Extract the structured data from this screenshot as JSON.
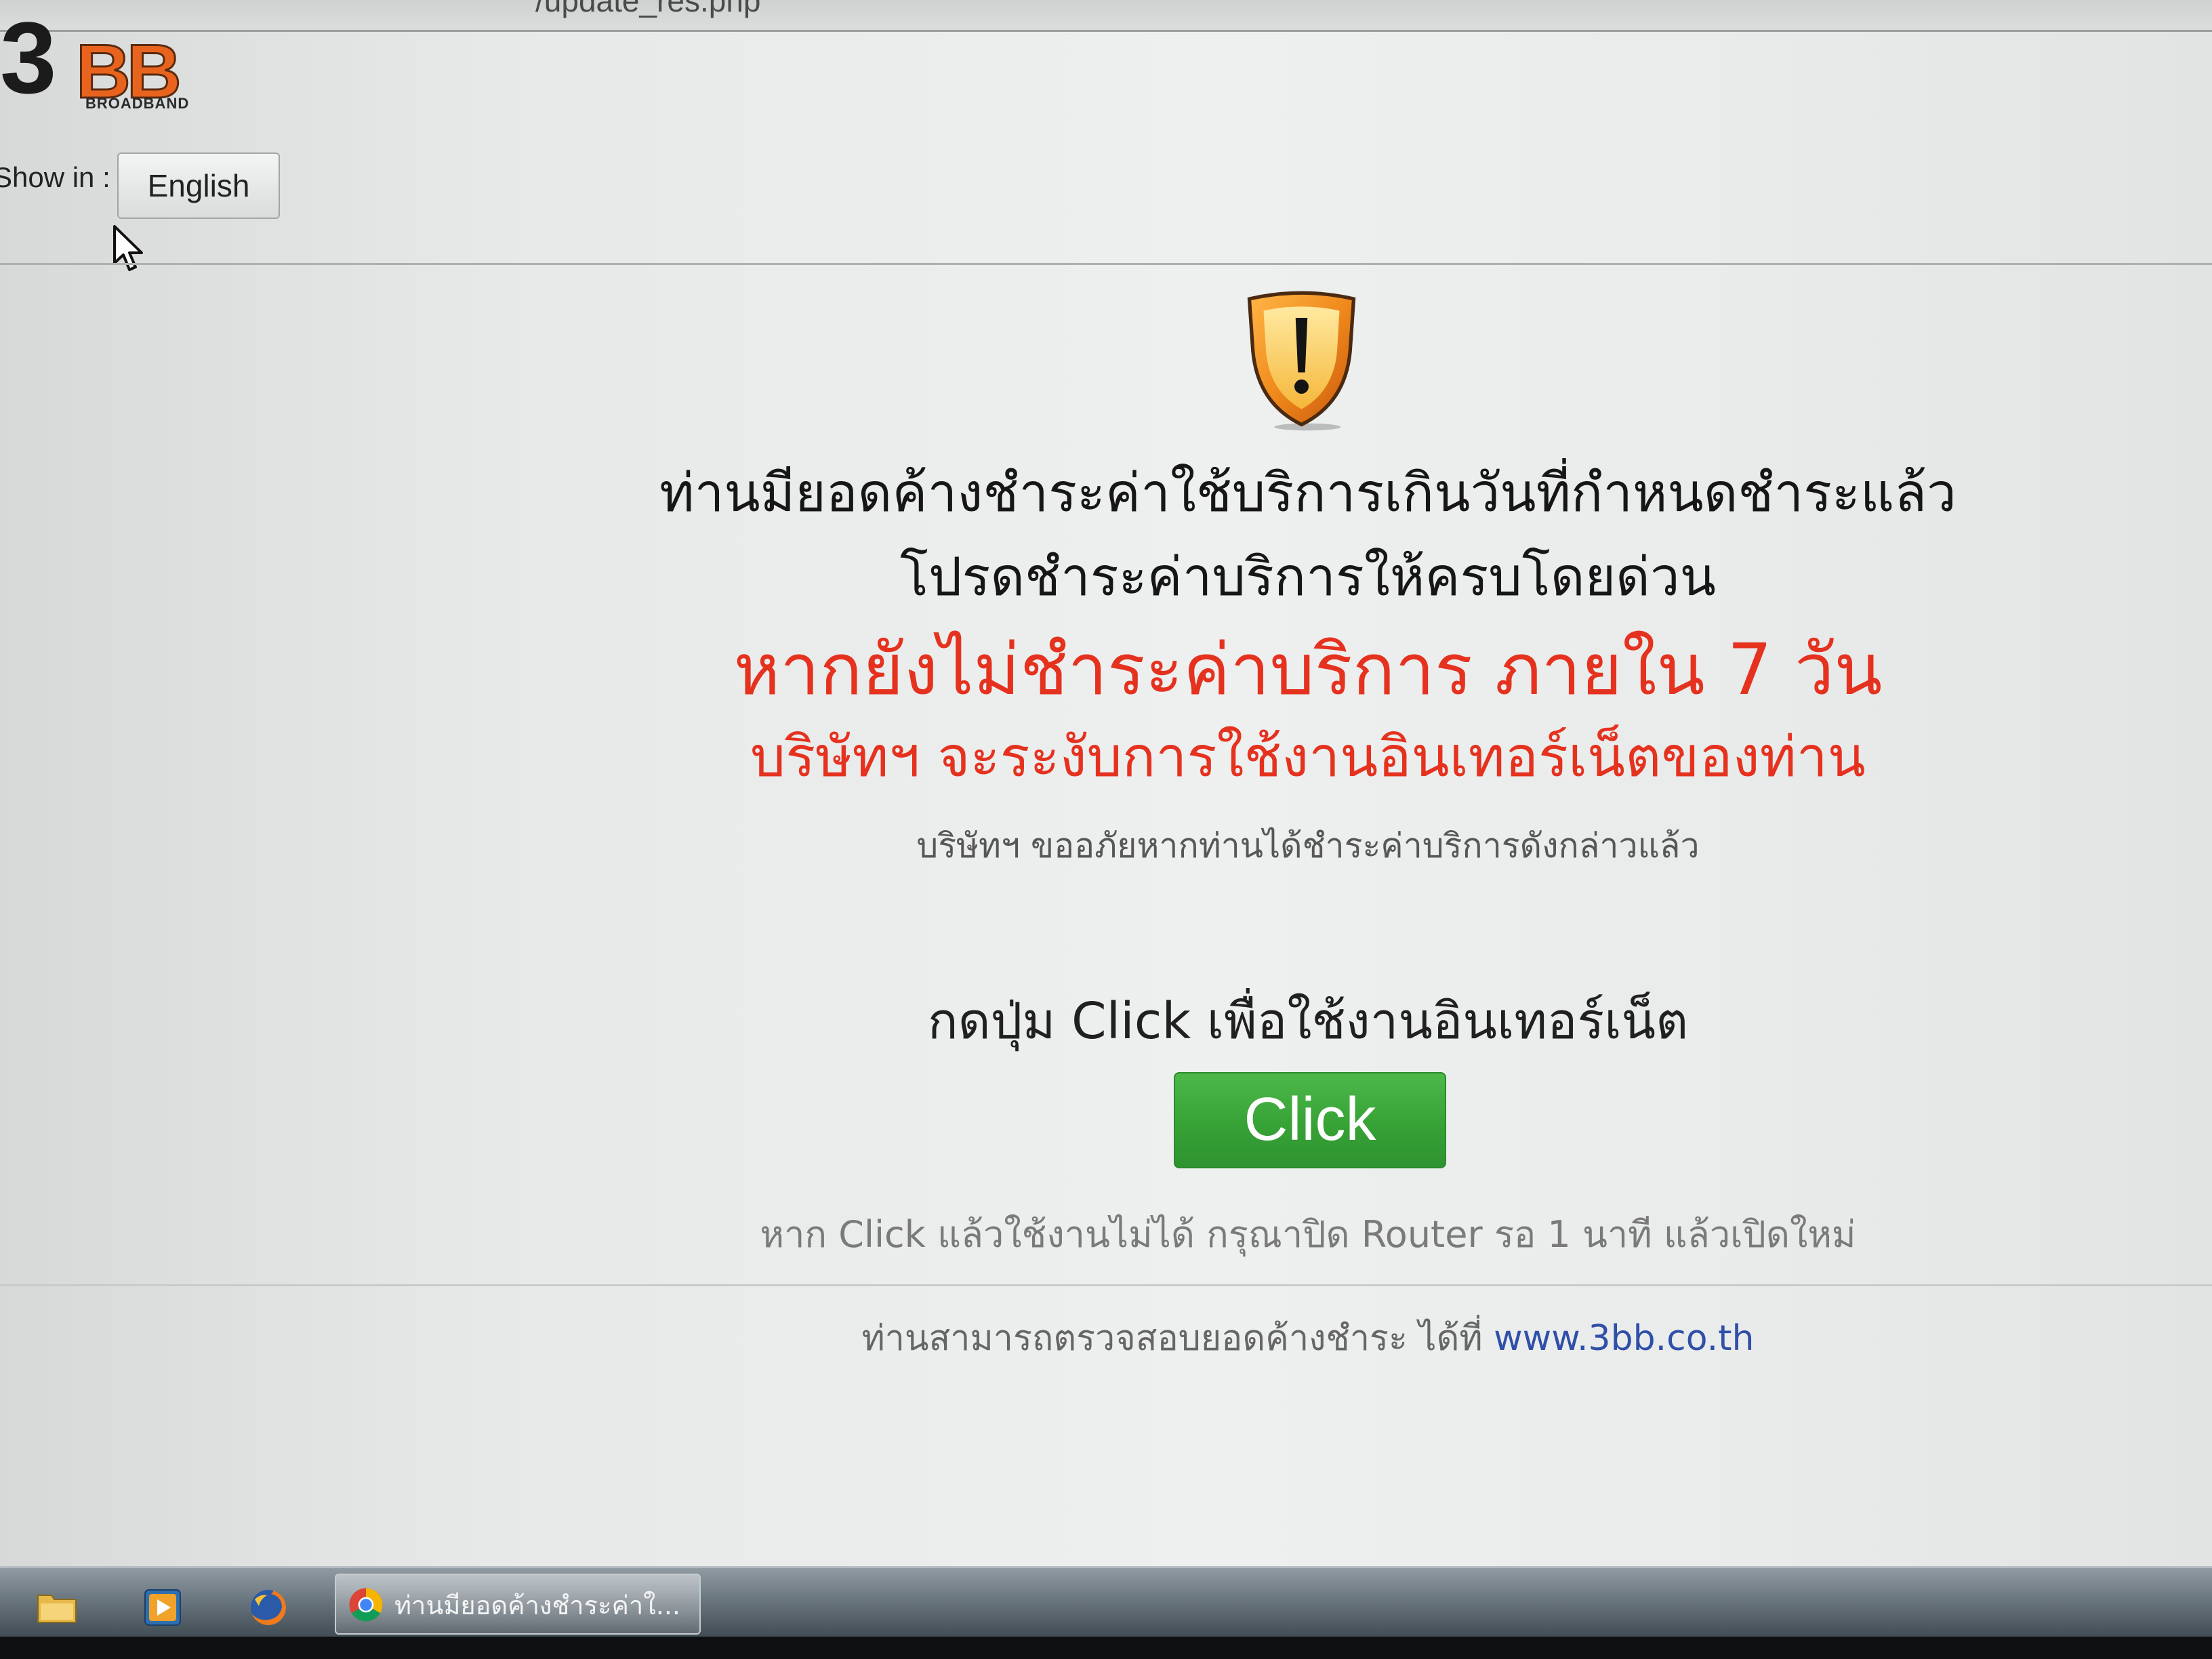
{
  "browser": {
    "address_fragment": "/update_res.php"
  },
  "header": {
    "logo_main": "3",
    "logo_bb": "BB",
    "logo_sub": "BROADBAND",
    "show_in_label": "Show in :",
    "language_button": "English"
  },
  "notice": {
    "line1": "ท่านมียอดค้างชำระค่าใช้บริการเกินวันที่กำหนดชำระแล้ว",
    "line2": "โปรดชำระค่าบริการให้ครบโดยด่วน",
    "warning_line1": "หากยังไม่ชำระค่าบริการ ภายใน 7 วัน",
    "warning_line2": "บริษัทฯ จะระงับการใช้งานอินเทอร์เน็ตของท่าน",
    "apology": "บริษัทฯ ขออภัยหากท่านได้ชำระค่าบริการดังกล่าวแล้ว",
    "instruction": "กดปุ่ม Click เพื่อใช้งานอินเทอร์เน็ต",
    "button_label": "Click",
    "router_hint": "หาก Click แล้วใช้งานไม่ได้ กรุณาปิด Router รอ 1 นาที แล้วเปิดใหม่",
    "check_text": "ท่านสามารถตรวจสอบยอดค้างชำระ ได้ที่ ",
    "check_link": "www.3bb.co.th"
  },
  "taskbar": {
    "icons": [
      "folder-icon",
      "media-player-icon",
      "firefox-icon",
      "chrome-icon"
    ],
    "active_window_title": "ท่านมียอดค้างชำระค่าใ..."
  },
  "icons": {
    "warning": "warning-shield-icon",
    "pointer": "mouse-cursor-icon"
  },
  "colors": {
    "warning_red": "#e5321f",
    "button_green": "#3ba53b",
    "link_blue": "#2f4fa8",
    "logo_orange": "#e8641e",
    "shield_orange": "#f08a1c"
  }
}
